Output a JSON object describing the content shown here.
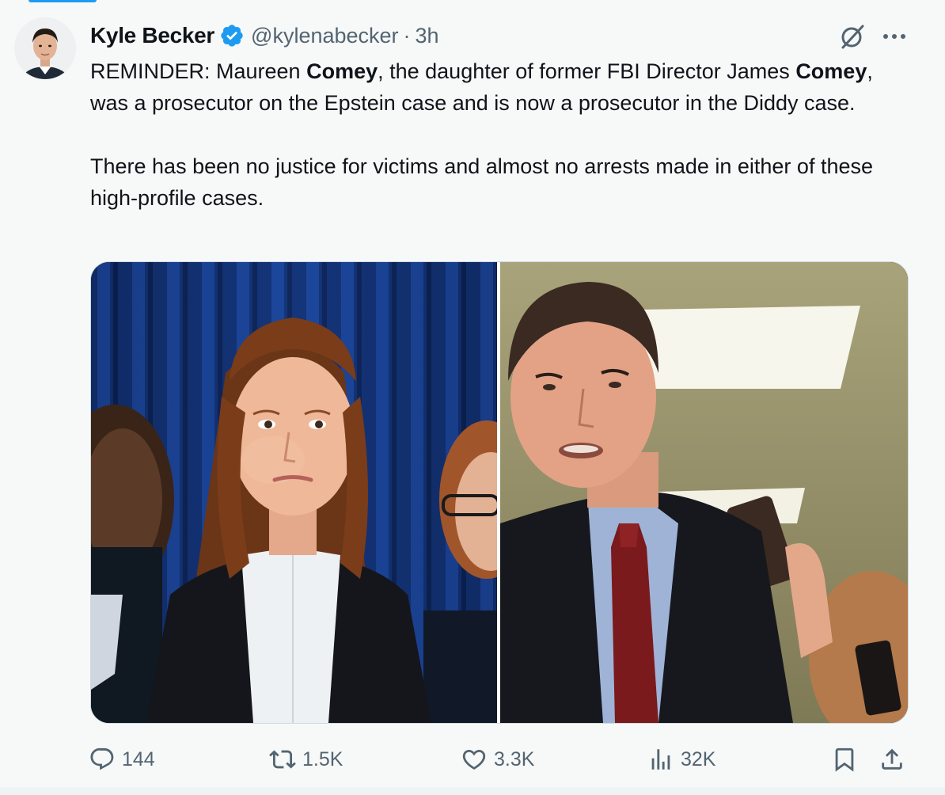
{
  "author": {
    "name": "Kyle Becker",
    "handle": "@kylenabecker",
    "separator": "·",
    "time": "3h",
    "verified": true
  },
  "tweet": {
    "p1_part1": "REMINDER: Maureen ",
    "p1_bold1": "Comey",
    "p1_part2": ", the daughter of former FBI Director James ",
    "p1_bold2": "Comey",
    "p1_part3": ", was a prosecutor on the Epstein case and is now a prosecutor in the Diddy case.",
    "p2": "There has been no justice for victims and almost no arrests made in either of these high-profile cases."
  },
  "actions": {
    "replies": "144",
    "reposts": "1.5K",
    "likes": "3.3K",
    "views": "32K"
  },
  "icons": {
    "verified": "verified-badge-icon",
    "grok": "grok-icon",
    "more": "more-icon",
    "reply": "reply-icon",
    "repost": "repost-icon",
    "like": "heart-icon",
    "views": "views-icon",
    "bookmark": "bookmark-icon",
    "share": "share-icon"
  },
  "colors": {
    "accent": "#1d9bf0",
    "text_primary": "#0f1419",
    "text_secondary": "#536471",
    "background": "#f7f9f9"
  }
}
